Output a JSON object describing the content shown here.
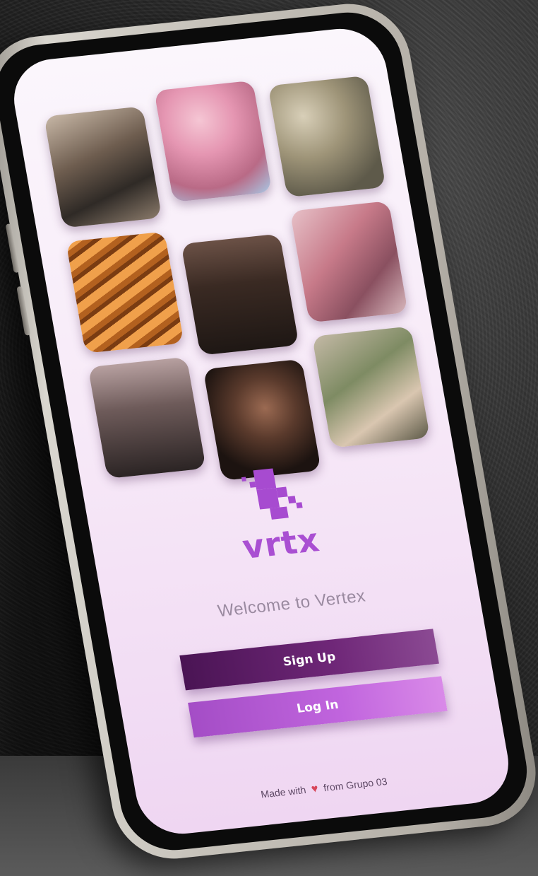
{
  "app": {
    "logo_text": "vrtx",
    "brand_color": "#a74bd0"
  },
  "gallery": {
    "photos": [
      {
        "icon": "photo-icon",
        "label": ""
      },
      {
        "icon": "photo-icon",
        "label": ""
      },
      {
        "icon": "photo-icon",
        "label": ""
      },
      {
        "icon": "photo-icon",
        "label": ""
      },
      {
        "icon": "photo-icon",
        "label": ""
      },
      {
        "icon": "photo-icon",
        "label": ""
      },
      {
        "icon": "photo-icon",
        "label": ""
      },
      {
        "icon": "photo-icon",
        "label": ""
      },
      {
        "icon": "photo-icon",
        "label": ""
      }
    ]
  },
  "welcome": {
    "text": "Welcome to Vertex"
  },
  "buttons": {
    "signup_label": "Sign Up",
    "login_label": "Log In",
    "signup_color": "#4a1454",
    "login_color": "#b55bd6"
  },
  "footer": {
    "prefix": "Made with",
    "suffix": "from Grupo 03",
    "heart_icon": "heart-icon"
  }
}
